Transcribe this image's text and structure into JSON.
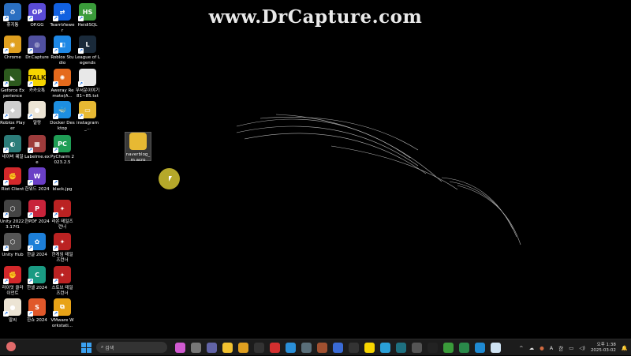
{
  "watermark": "www.DrCapture.com",
  "desktop": {
    "rows": [
      [
        {
          "label": "휴지통",
          "color": "#2b6fc1",
          "glyph": "♻"
        },
        {
          "label": "OP.GG",
          "color": "#5a4bd6",
          "glyph": "OP"
        },
        {
          "label": "TeamViewer",
          "color": "#1160e0",
          "glyph": "⇄"
        },
        {
          "label": "HeidiSQL",
          "color": "#3a9b3a",
          "glyph": "HS"
        }
      ],
      [
        {
          "label": "Chrome",
          "color": "#e0a020",
          "glyph": "◉"
        },
        {
          "label": "Dr.Capture",
          "color": "#5050a0",
          "glyph": "◎"
        },
        {
          "label": "Roblox Studio",
          "color": "#1e88e5",
          "glyph": "◧"
        },
        {
          "label": "League of Legends",
          "color": "#1a2a3a",
          "glyph": "L"
        }
      ],
      [
        {
          "label": "Geforce Experience",
          "color": "#2d5a1e",
          "glyph": "◣"
        },
        {
          "label": "카카오톡",
          "color": "#f6d500",
          "glyph": "TALK"
        },
        {
          "label": "Aweray Remote(A...",
          "color": "#e56a1c",
          "glyph": "✺"
        },
        {
          "label": "무서운이야기 81~85.txt",
          "color": "#e8e8e8",
          "glyph": ""
        }
      ],
      [
        {
          "label": "Roblox Player",
          "color": "#cfcfcf",
          "glyph": "◆"
        },
        {
          "label": "말랑",
          "color": "#ece4d4",
          "glyph": "●"
        },
        {
          "label": "Docker Desktop",
          "color": "#1d8fe1",
          "glyph": "🐳"
        },
        {
          "label": "instagram_...",
          "color": "#e7b933",
          "glyph": "▭"
        }
      ],
      [
        {
          "label": "네이버 웨일",
          "color": "#2c7d7a",
          "glyph": "◐"
        },
        {
          "label": "Labelme.exe",
          "color": "#9d3b3b",
          "glyph": "▦"
        },
        {
          "label": "PyCharm 2023.2.5",
          "color": "#1f9d55",
          "glyph": "PC"
        },
        null
      ],
      [
        {
          "label": "Riot Client",
          "color": "#d3282b",
          "glyph": "✊"
        },
        {
          "label": "한워드 2024",
          "color": "#6a3fc6",
          "glyph": "W"
        },
        {
          "label": "black.jpg",
          "color": "#000",
          "glyph": ""
        },
        null
      ],
      [
        {
          "label": "Unity 2022.3.17f1",
          "color": "#444",
          "glyph": "⬡"
        },
        {
          "label": "한PDF 2024",
          "color": "#c8233a",
          "glyph": "P"
        },
        {
          "label": "라온 테일즈런너",
          "color": "#b22",
          "glyph": "✦"
        },
        null
      ],
      [
        {
          "label": "Unity Hub",
          "color": "#555",
          "glyph": "⬡"
        },
        {
          "label": "한글 2024",
          "color": "#1d7fd8",
          "glyph": "✿"
        },
        {
          "label": "한게임 테일즈런너",
          "color": "#b22",
          "glyph": "✦"
        },
        null
      ],
      [
        {
          "label": "라이엇 클라이언트",
          "color": "#d3282b",
          "glyph": "✊"
        },
        {
          "label": "한셀 2024",
          "color": "#1a9b83",
          "glyph": "C"
        },
        {
          "label": "스토브 테일즈런너",
          "color": "#b22",
          "glyph": "✦"
        },
        null
      ],
      [
        {
          "label": "말씨",
          "color": "#ece4d4",
          "glyph": "●"
        },
        {
          "label": "한쇼 2024",
          "color": "#e0582a",
          "glyph": "S"
        },
        {
          "label": "VMware Workstati...",
          "color": "#e8a317",
          "glyph": "⧉"
        },
        null
      ]
    ],
    "selected_file": {
      "label": "naverblog_m acro",
      "color": "#e7b933"
    }
  },
  "taskbar": {
    "search_placeholder": "검색",
    "apps": [
      {
        "name": "copilot",
        "color": "#d05ad0"
      },
      {
        "name": "task-view",
        "color": "#777"
      },
      {
        "name": "teams",
        "color": "#6264a7"
      },
      {
        "name": "file-explorer",
        "color": "#f2c230"
      },
      {
        "name": "chrome",
        "color": "#e0a020"
      },
      {
        "name": "terminal",
        "color": "#333"
      },
      {
        "name": "dr-capture",
        "color": "#d32f2f"
      },
      {
        "name": "app-blue",
        "color": "#2a8fd8"
      },
      {
        "name": "app-grey",
        "color": "#5a6f7a"
      },
      {
        "name": "app-photo",
        "color": "#a05030"
      },
      {
        "name": "app-circle",
        "color": "#3a6bd6"
      },
      {
        "name": "app-dark",
        "color": "#333"
      },
      {
        "name": "kakaotalk",
        "color": "#f6d500"
      },
      {
        "name": "app-cyan",
        "color": "#2aa0d8"
      },
      {
        "name": "app-teal",
        "color": "#1e7080"
      },
      {
        "name": "app-hex",
        "color": "#555"
      },
      {
        "name": "console",
        "color": "#222"
      },
      {
        "name": "heidisql",
        "color": "#3a9b3a"
      },
      {
        "name": "app-green",
        "color": "#2a8a4a"
      },
      {
        "name": "vscode",
        "color": "#1f8ad2"
      },
      {
        "name": "app-white",
        "color": "#d0e4f4"
      }
    ],
    "tray": {
      "ime_a": "A",
      "ime_han": "한",
      "time": "오후 1:38",
      "date": "2025-03-02"
    }
  }
}
